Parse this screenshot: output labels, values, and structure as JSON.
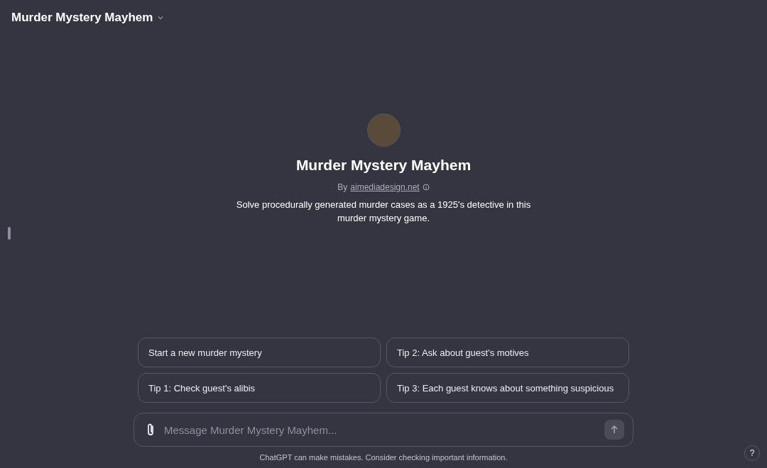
{
  "header": {
    "title": "Murder Mystery Mayhem"
  },
  "intro": {
    "name": "Murder Mystery Mayhem",
    "by": "By",
    "author": "aimediadesign.net",
    "description": "Solve procedurally generated murder cases as a 1925's detective in this murder mystery game."
  },
  "suggestions": [
    {
      "label": "Start a new murder mystery"
    },
    {
      "label": "Tip 2: Ask about guest's motives"
    },
    {
      "label": "Tip 1: Check guest's alibis"
    },
    {
      "label": "Tip 3: Each guest knows about something suspicious"
    }
  ],
  "composer": {
    "placeholder": "Message Murder Mystery Mayhem..."
  },
  "footer": {
    "disclaimer": "ChatGPT can make mistakes. Consider checking important information.",
    "help": "?"
  }
}
